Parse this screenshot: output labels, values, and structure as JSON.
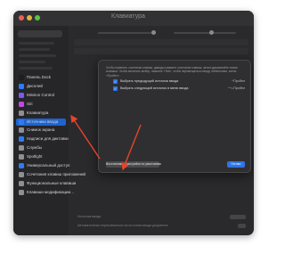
{
  "window": {
    "title": "Клавиатура"
  },
  "sidebar": {
    "items": [
      {
        "label": "Панель Dock",
        "color": "#1e1e1e",
        "selected": false
      },
      {
        "label": "Дисплей",
        "color": "#2f7bf5",
        "selected": false
      },
      {
        "label": "Mission Control",
        "color": "#7a5af5",
        "selected": false
      },
      {
        "label": "Siri",
        "color": "#c04ae0",
        "selected": false
      },
      {
        "label": "Клавиатура",
        "color": "#8e8e93",
        "selected": false
      },
      {
        "label": "Источники ввода",
        "color": "#2f7bf5",
        "selected": true
      },
      {
        "label": "Снимок экрана",
        "color": "#8e8e93",
        "selected": false
      },
      {
        "label": "Надписи для диктовки",
        "color": "#2f7bf5",
        "selected": false
      },
      {
        "label": "Службы",
        "color": "#8e8e93",
        "selected": false
      },
      {
        "label": "Spotlight",
        "color": "#8e8e93",
        "selected": false
      },
      {
        "label": "Универсальный доступ",
        "color": "#2f7bf5",
        "selected": false
      },
      {
        "label": "Сочетания клавиш приложений",
        "color": "#8e8e93",
        "selected": false
      },
      {
        "label": "Функциональные клавиши",
        "color": "#8e8e93",
        "selected": false
      },
      {
        "label": "Клавиши модификации…",
        "color": "#8e8e93",
        "selected": false
      }
    ]
  },
  "sheet": {
    "description": "Чтобы изменить сочетание клавиш, дважды нажмите сочетание клавиш, затем удерживайте новые клавиши. Чтобы включить выбор, нажмите «Tab», чтобы перемещаться между элементами, затем «Пробел».",
    "options": [
      {
        "label": "Выбрать предыдущий источник ввода",
        "shortcut": "^Пробел",
        "checked": true
      },
      {
        "label": "Выбрать следующий источник в меню ввода",
        "shortcut": "^⌥Пробел",
        "checked": true
      }
    ],
    "restore_label": "Восстановить настройки по умолчанию",
    "done_label": "Готово"
  },
  "background": {
    "bottom_rows": [
      {
        "label": "Источник ввода"
      },
      {
        "label": "Автоматически переключаться на источник ввода документа"
      }
    ]
  },
  "colors": {
    "accent": "#2f74e6",
    "arrow": "#e8442a",
    "window_bg": "#2a2a2c"
  }
}
